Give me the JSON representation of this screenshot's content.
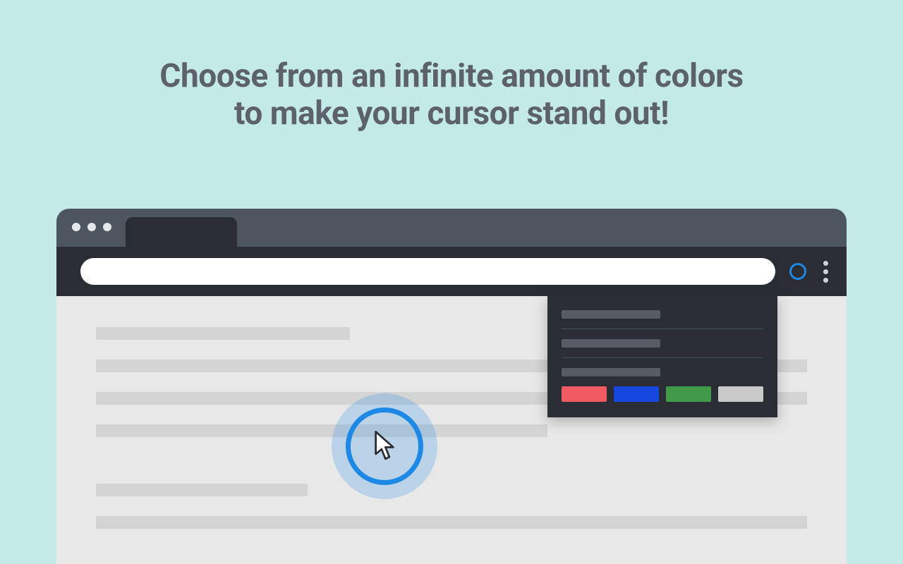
{
  "headline": {
    "line1": "Choose from an infinite amount of colors",
    "line2": "to make your cursor stand out!"
  },
  "popup": {
    "swatches": [
      "#ef5a62",
      "#1648e0",
      "#3f9b4a",
      "#c9c9c9"
    ]
  },
  "colors": {
    "accent": "#1d88e6",
    "background": "#c4eae6",
    "chrome_dark": "#2a2e34",
    "chrome_mid": "#4d555e"
  }
}
